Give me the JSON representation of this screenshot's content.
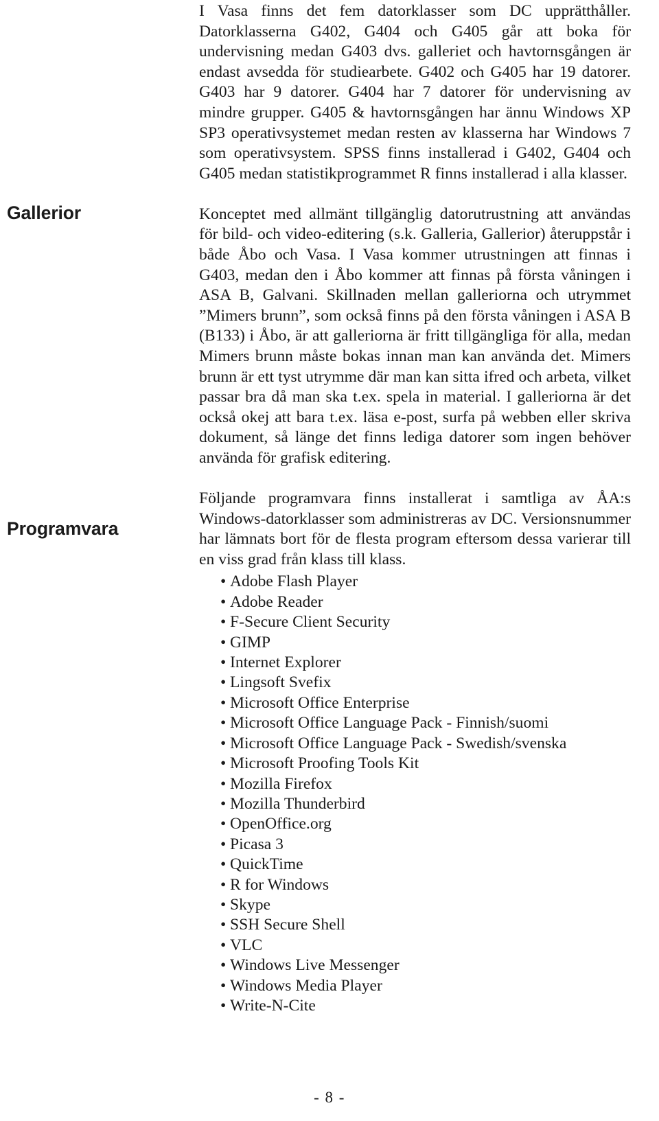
{
  "document": {
    "language": "sv",
    "page_number_label": "- 8 -"
  },
  "margin_headings": [
    {
      "id": "gallerior",
      "label": "Gallerior"
    },
    {
      "id": "programvara",
      "label": "Programvara"
    }
  ],
  "paragraphs": {
    "intro": "I Vasa finns det fem datorklasser som DC upprätthåller. Datorklasserna G402, G404 och G405 går att boka för undervisning medan G403 dvs. galleriet och havtornsgången är endast avsedda för studiearbete. G402 och G405 har 19 datorer. G403 har 9 datorer. G404 har 7 datorer för undervisning av mindre grupper. G405 & havtornsgången har ännu Windows XP SP3 operativsystemet medan resten av klasserna har Windows 7 som operativsystem. SPSS finns installerad i G402, G404 och G405 medan statistikprogrammet R finns installerad i alla klasser.",
    "gallerior": "Konceptet med allmänt tillgänglig datorutrustning att användas för bild- och video-editering (s.k. Galleria, Gallerior) återuppstår i både Åbo och Vasa. I Vasa kommer utrustningen att finnas i G403, medan den i Åbo kommer att finnas på första våningen i ASA B, Galvani. Skillnaden mellan galleriorna och utrymmet ”Mimers brunn”, som också finns på den första våningen i ASA B (B133) i Åbo, är att galleriorna är fritt tillgängliga för alla, medan Mimers brunn måste bokas innan man kan använda det. Mimers brunn är ett tyst utrymme där man kan sitta ifred och arbeta, vilket passar bra då man ska t.ex. spela in material. I galleriorna är det också okej att bara t.ex. läsa e-post, surfa på webben eller skriva dokument, så länge det finns lediga datorer som ingen behöver använda för grafisk editering.",
    "programvara": "Följande programvara finns installerat i samtliga av ÅA:s Windows-datorklasser som administreras av DC. Versionsnummer har lämnats bort för de flesta program eftersom dessa varierar till en viss grad från klass till klass."
  },
  "software_list": {
    "bullet_glyph": "•",
    "items": [
      "Adobe Flash Player",
      "Adobe Reader",
      "F-Secure Client Security",
      "GIMP",
      "Internet Explorer",
      "Lingsoft Svefix",
      "Microsoft Office Enterprise",
      "Microsoft Office Language Pack - Finnish/suomi",
      "Microsoft Office Language Pack - Swedish/svenska",
      "Microsoft Proofing Tools Kit",
      "Mozilla Firefox",
      "Mozilla Thunderbird",
      "OpenOffice.org",
      "Picasa 3",
      "QuickTime",
      "R for Windows",
      "Skype",
      "SSH Secure Shell",
      "VLC",
      "Windows Live Messenger",
      "Windows Media Player",
      "Write-N-Cite"
    ]
  },
  "colors": {
    "page_background": "#ffffff",
    "body_text": "#1a1a1a",
    "heading_text": "#1b1b1b"
  }
}
